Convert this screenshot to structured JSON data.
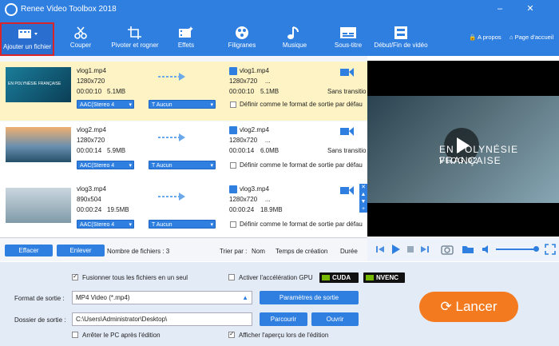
{
  "app": {
    "title": "Renee Video Toolbox 2018"
  },
  "window_buttons": {
    "minimize": "–",
    "close": "✕"
  },
  "toolbar": {
    "add": "Ajouter un fichier",
    "cut": "Couper",
    "rotate": "Pivoter et rogner",
    "effects": "Effets",
    "watermark": "Filigranes",
    "music": "Musique",
    "subtitle": "Sous-titre",
    "startend": "Début/Fin de vidéo"
  },
  "header_links": {
    "about": "A propos",
    "home": "Page d'accueil"
  },
  "files": [
    {
      "name": "vlog1.mp4",
      "res": "1280x720",
      "dur": "00:00:10",
      "size": "5.1MB",
      "out_name": "vlog1.mp4",
      "out_res": "1280x720",
      "out_res_more": "...",
      "out_dur": "00:00:10",
      "out_size": "5.1MB",
      "audio": "AAC(Stereo 4",
      "sub": "Aucun",
      "transition": "Sans transitio",
      "default_fmt": "Définir comme le format de sortie par défau",
      "thumb_title": "EN POLYNÉSIE FRANÇAISE"
    },
    {
      "name": "vlog2.mp4",
      "res": "1280x720",
      "dur": "00:00:14",
      "size": "5.9MB",
      "out_name": "vlog2.mp4",
      "out_res": "1280x720",
      "out_res_more": "...",
      "out_dur": "00:00:14",
      "out_size": "6.0MB",
      "audio": "AAC(Stereo 4",
      "sub": "Aucun",
      "transition": "Sans transitio",
      "default_fmt": "Définir comme le format de sortie par défau"
    },
    {
      "name": "vlog3.mp4",
      "res": "890x504",
      "dur": "00:00:24",
      "size": "19.5MB",
      "out_name": "vlog3.mp4",
      "out_res": "1280x720",
      "out_res_more": "...",
      "out_dur": "00:00:24",
      "out_size": "18.9MB",
      "audio": "AAC(Stereo 4",
      "sub": "Aucun",
      "default_fmt": "Définir comme le format de sortie par défau"
    }
  ],
  "preview": {
    "title": "EN POLYNÉSIE FRANÇAISE",
    "subtitle": "VLOG 02"
  },
  "listfoot": {
    "clear": "Effacer",
    "remove": "Enlever",
    "count": "Nombre de fichiers : 3",
    "sort_by": "Trier par :",
    "sort_name": "Nom",
    "sort_time": "Temps de création",
    "sort_dur": "Durée"
  },
  "options": {
    "merge": "Fusionner tous les fichiers en un seul",
    "gpu": "Activer l'accélération GPU",
    "cuda": "CUDA",
    "nvenc": "NVENC",
    "format_label": "Format de sortie :",
    "format_value": "MP4 Video (*.mp4)",
    "params": "Paramètres de sortie",
    "folder_label": "Dossier de sortie :",
    "folder_value": "C:\\Users\\Administrator\\Desktop\\",
    "browse": "Parcourir",
    "open": "Ouvrir",
    "shutdown": "Arrêter le PC après l'édition",
    "show_preview": "Afficher l'aperçu lors de l'édition",
    "start": "Lancer"
  },
  "colors": {
    "accent": "#2f7fe0",
    "start": "#f47a20",
    "selected_row": "#fdf3c4"
  }
}
